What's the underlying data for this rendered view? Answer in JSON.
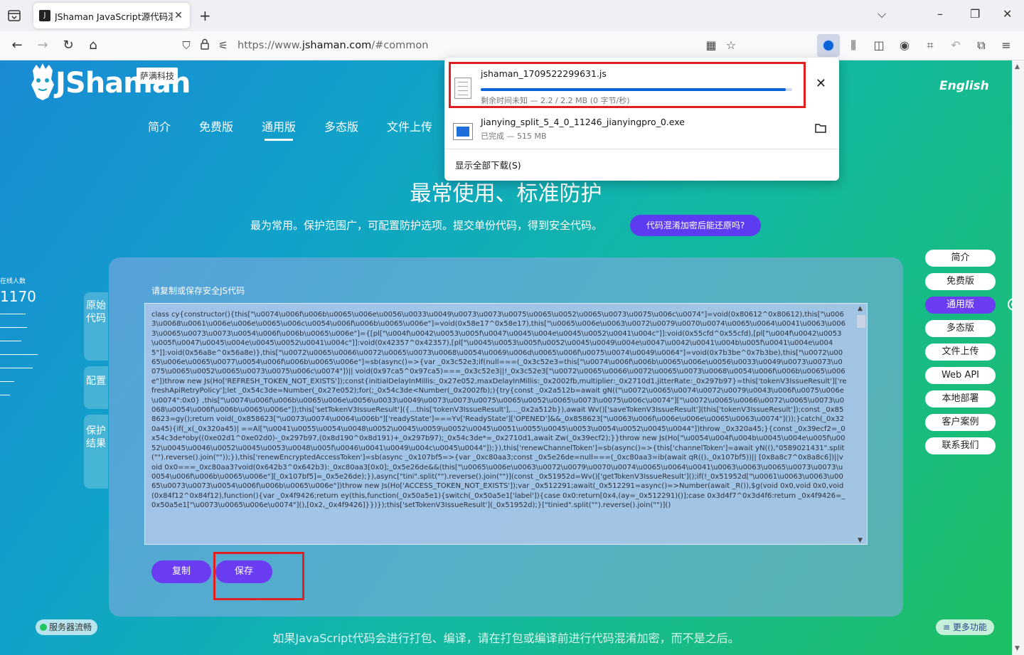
{
  "browser": {
    "tab_title": "JShaman JavaScript源代码混淆",
    "url_prefix": "https://www.",
    "url_domain": "jshaman.com",
    "url_suffix": "/#common",
    "accent_color": "#0a64d6"
  },
  "downloads": {
    "items": [
      {
        "name": "jshaman_1709522299631.js",
        "status": "剩余时间未知 — 2.2 / 2.2 MB (0 字节/秒)",
        "progress": 0.98,
        "action_icon": "close-icon"
      },
      {
        "name": "Jianying_split_5_4_0_11246_jianyingpro_0.exe",
        "status": "已完成 — 515 MB",
        "action_icon": "folder-icon"
      }
    ],
    "show_all": "显示全部下载(S)"
  },
  "site": {
    "logo_text": "JShaman",
    "logo_badge": "萨满科技",
    "language": "English",
    "nav": [
      {
        "label": "简介"
      },
      {
        "label": "免费版"
      },
      {
        "label": "通用版",
        "active": true
      },
      {
        "label": "多态版"
      },
      {
        "label": "文件上传"
      }
    ],
    "hero_title": "最常使用、标准防护",
    "hero_subtitle": "最为常用。保护范围广，可配置防护选项。提交单份代码，得到安全代码。",
    "hero_button": "代码混淆加密后能还原吗?",
    "online_label": "在线人数",
    "online_count": "1170",
    "side_tabs": [
      "原始代码",
      "配置",
      "保护结果"
    ],
    "panel_label": "请复制或保存安全JS代码",
    "code": "class cy{constructor(){this[\"\\u0074\\u006f\\u006b\\u0065\\u006e\\u0056\\u0033\\u0049\\u0073\\u0073\\u0075\\u0065\\u0052\\u0065\\u0073\\u0075\\u006c\\u0074\"]=void(0x80612^0x80612),this[\"\\u0063\\u0068\\u0061\\u006e\\u006e\\u0065\\u006c\\u0054\\u006f\\u006b\\u0065\\u006e\"]=void(0x58e17^0x58e17),this[\"\\u0065\\u006e\\u0063\\u0072\\u0079\\u0070\\u0074\\u0065\\u0064\\u0041\\u0063\\u0063\\u0065\\u0073\\u0073\\u0054\\u006f\\u006b\\u0065\\u006e\"]={[pl[\"\\u004f\\u0042\\u0053\\u005f\\u0047\\u0045\\u004e\\u0045\\u0052\\u0041\\u004c\"]]:void(0x55cfd^0x55cfd),[pl[\"\\u004f\\u0042\\u0053\\u005f\\u0047\\u0045\\u004e\\u0045\\u0052\\u0041\\u004c\"]]:void(0x42357^0x42357),[pl[\"\\u0045\\u0053\\u005f\\u0052\\u0045\\u0049\\u004e\\u0047\\u0042\\u0041\\u004b\\u005f\\u0041\\u004e\\u0045\"]]:void(0x56a8e^0x56a8e)},this[\"\\u0072\\u0065\\u0066\\u0072\\u0065\\u0073\\u0068\\u0054\\u0069\\u006d\\u0065\\u006f\\u0075\\u0074\\u0049\\u0064\"]=void(0x7b3be^0x7b3be),this[\"\\u0072\\u0065\\u006e\\u0065\\u0077\\u0054\\u006f\\u006b\\u0065\\u006e\"]=sb(async()=>{var _0x3c52e3;if(null===(_0x3c52e3=this[\"\\u0074\\u006f\\u006b\\u0065\\u006e\\u0056\\u0033\\u0049\\u0073\\u0073\\u0075\\u0065\\u0052\\u0065\\u0073\\u0075\\u006c\\u0074\"])|| void(0x97ca5^0x97ca5)===_0x3c52e3||!_0x3c52e3[\"\\u0072\\u0065\\u0066\\u0072\\u0065\\u0073\\u0068\\u0054\\u006f\\u006b\\u0065\\u006e\"])throw new Js(Ho['REFRESH_TOKEN_NOT_EXISTS']);const{initialDelayInMillis:_0x27e052,maxDelayInMillis:_0x2002fb,multiplier:_0x2710d1,jitterRate:_0x297b97}=this['tokenV3IssueResult']['refreshApiRetryPolicy'];let _0x54c3de=Number(_0x27e052);for(;_0x54c3de<Number(_0x2002fb);){try{const _0x2a512b=await gN((\"\\u0072\\u0065\\u0074\\u0072\\u0079\\u0043\\u006f\\u0075\\u006e\\u0074\":0x0} ,this[\"\\u0074\\u006f\\u006b\\u0065\\u006e\\u0056\\u0033\\u0049\\u0073\\u0073\\u0075\\u0065\\u0052\\u0065\\u0073\\u0075\\u006c\\u0074\"][\"\\u0072\\u0065\\u0066\\u0072\\u0065\\u0073\\u0068\\u0054\\u006f\\u006b\\u0065\\u006e\"]);this['setTokenV3IssueResult']({...this['tokenV3IssueResult'],..._0x2a512b}),await Wv()['saveTokenV3IssueResult'](this['tokenV3IssueResult']);const _0x858623=gy();return void(_0x858623[\"\\u0073\\u0074\\u0064\\u006b\"]['readyState']===Yv['ReadyState']['OPENED']&&_0x858623[\"\\u0063\\u006f\\u006e\\u006e\\u0065\\u0063\\u0074\"]());}catch(_0x320a45){if(_x(_0x320a45)| ==Al[\"\\u0041\\u0055\\u0054\\u0048\\u0052\\u0045\\u0059\\u0052\\u0045\\u0051\\u0055\\u0045\\u0053\\u0054\\u0052\\u0045\\u0044\"])throw _0x320a45;}{const _0x39ecf2=_0x54c3de*oby((0xe02d1^0xe02d0)-_0x297b97,(0x8d190^0x8d191)+_0x297b97);_0x54c3de*=_0x2710d1,await Zw(_0x39ecf2);}}throw new Js(Ho[\"\\u0054\\u004f\\u004b\\u0045\\u004e\\u005f\\u0052\\u0045\\u0046\\u0052\\u0045\\u0053\\u0048\\u005f\\u0046\\u0041\\u0049\\u004c\\u0045\\u0044\"]);}),this['renewChannelToken']=sb(async()=>{this['channelToken']=await yN((),\"0589021431\".split(\"\").reverse().join(\"\"));}),this['renewEncryptedAccessToken']=sb(async _0x107bf5=>{var _0xc80aa3;const _0x5e26de=null===(_0xc80aa3=ib(await qR((),_0x107bf5))|| [0x8a8c7^0x8a8c6])||void 0x0===_0xc80aa3?void(0x642b3^0x642b3):_0xc80aa3[0x0];_0x5e26de&&(this[\"\\u0065\\u006e\\u0063\\u0072\\u0079\\u0070\\u0074\\u0065\\u0064\\u0041\\u0063\\u0063\\u0065\\u0073\\u0073\\u0054\\u006f\\u006b\\u0065\\u006e\"][_0x107bf5]=_0x5e26de);}),async[\"tini\".split(\"\").reverse().join(\"\")](const _0x51952d=Wv()['getTokenV3IssueResult']();if(!_0x51952d[\"\\u0061\\u0063\\u0063\\u0065\\u0073\\u0073\\u0054\\u006f\\u006b\\u0065\\u006e\"])throw new Js(Ho['ACCESS_TOKEN_NOT_EXISTS']);var _0x512291;await(_0x512291=async()=>Number(await _R()),$g(void 0x0,void 0x0,void(0x84f12^0x84f12),function(){var _0x4f9426;return ey(this,function(_0x50a5e1){switch(_0x50a5e1['label']){case 0x0:return[0x4,(ay=_0x512291)()];case 0x3d4f7^0x3d4f6:return _0x4f9426=_0x50a5e1[\"\\u0073\\u0065\\u006e\\u0074\"](),[0x2,_0x4f9426]}})});this['setTokenV3IssueResult'](_0x51952d);}[\"tinied\".split(\"\").reverse().join(\"\")]()",
    "copy_button": "复制",
    "save_button": "保存",
    "right_nav": [
      {
        "label": "简介"
      },
      {
        "label": "免费版"
      },
      {
        "label": "通用版",
        "active": true
      },
      {
        "label": "多态版"
      },
      {
        "label": "文件上传"
      },
      {
        "label": "Web API"
      },
      {
        "label": "本地部署"
      },
      {
        "label": "客户案例"
      },
      {
        "label": "联系我们"
      }
    ],
    "server_status": "服务器流畅",
    "footer_note": "如果JavaScript代码会进行打包、编译，请在打包或编译前进行代码混淆加密，而不是之后。",
    "more_features": "≡ 更多功能",
    "primary_color": "#6a3cf2"
  }
}
